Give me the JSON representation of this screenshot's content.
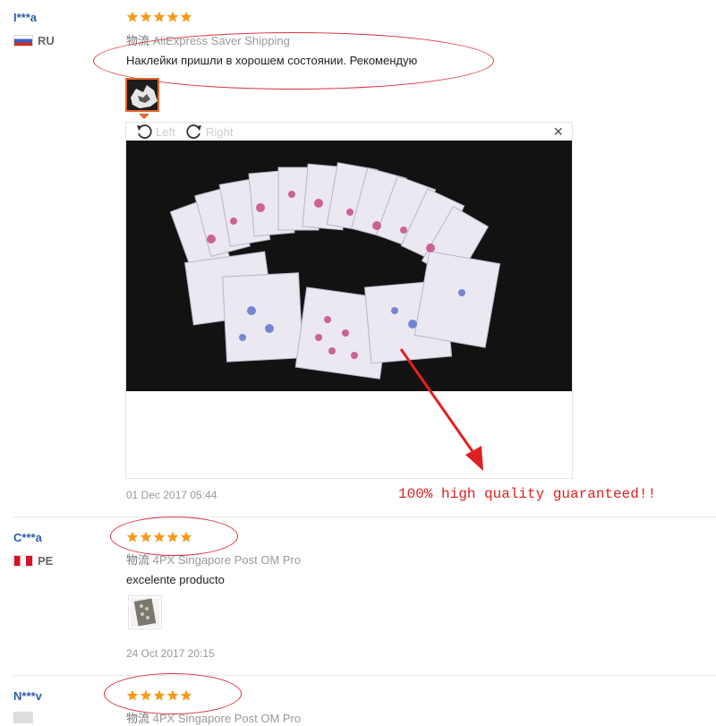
{
  "reviews": [
    {
      "name": "I***a",
      "country": "RU",
      "shipping_prefix": "物流",
      "shipping": "AliExpress Saver Shipping",
      "text": "Наклейки пришли в хорошем состоянии. Рекомендую",
      "date": "01 Dec 2017 05:44",
      "rating": 5
    },
    {
      "name": "C***a",
      "country": "PE",
      "shipping_prefix": "物流",
      "shipping": "4PX Singapore Post OM Pro",
      "text": "excelente producto",
      "date": "24 Oct 2017 20:15",
      "rating": 5
    },
    {
      "name": "N***v",
      "country": "",
      "shipping_prefix": "物流",
      "shipping": "4PX Singapore Post OM Pro",
      "rating": 5
    }
  ],
  "viewer": {
    "rotate_left": "Left",
    "rotate_right": "Right",
    "close": "×"
  },
  "annotation": {
    "guarantee": "100% high quality guaranteed!!"
  },
  "colors": {
    "star": "#f29b1a",
    "name": "#2b5ea7",
    "annotation_red": "#d9333a"
  }
}
